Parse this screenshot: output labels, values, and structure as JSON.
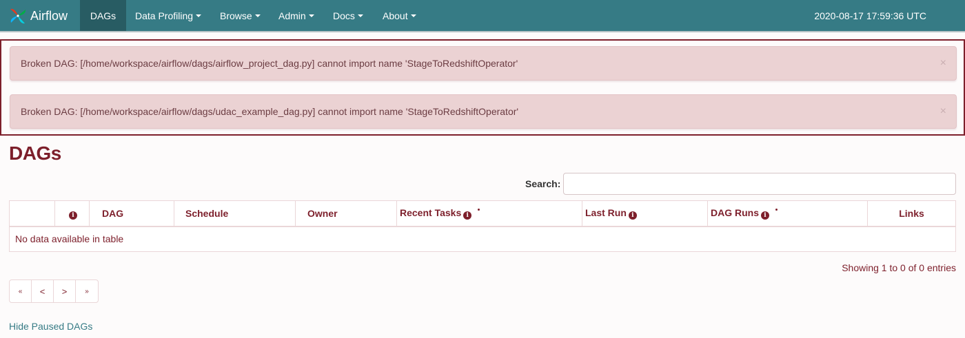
{
  "navbar": {
    "brand": "Airflow",
    "items": [
      {
        "label": "DAGs"
      },
      {
        "label": "Data Profiling"
      },
      {
        "label": "Browse"
      },
      {
        "label": "Admin"
      },
      {
        "label": "Docs"
      },
      {
        "label": "About"
      }
    ],
    "clock": "2020-08-17 17:59:36 UTC",
    "color": "#367b85"
  },
  "alerts": [
    {
      "text": "Broken DAG: [/home/workspace/airflow/dags/airflow_project_dag.py] cannot import name 'StageToRedshiftOperator'",
      "close": "×"
    },
    {
      "text": "Broken DAG: [/home/workspace/airflow/dags/udac_example_dag.py] cannot import name 'StageToRedshiftOperator'",
      "close": "×"
    }
  ],
  "page": {
    "title": "DAGs",
    "search_label": "Search:",
    "search_value": ""
  },
  "table": {
    "headers": [
      "",
      "",
      "DAG",
      "Schedule",
      "Owner",
      "Recent Tasks",
      "Last Run",
      "DAG Runs",
      "Links"
    ],
    "empty_message": "No data available in table"
  },
  "footer": {
    "showing": "Showing 1 to 0 of 0 entries",
    "pager": [
      "«",
      "<",
      ">",
      "»"
    ],
    "hide_paused": "Hide Paused DAGs"
  },
  "colors": {
    "accent": "#7d1f2b",
    "alert_bg": "#ebd2d3",
    "link": "#367b85"
  }
}
